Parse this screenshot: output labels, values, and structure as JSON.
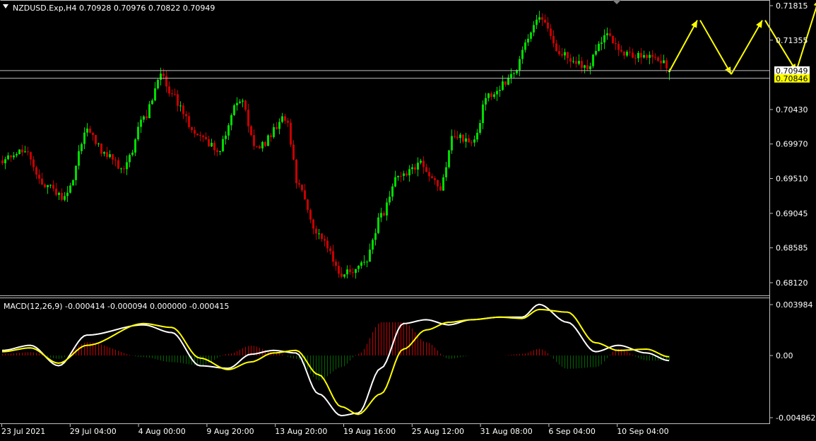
{
  "main_info": "NZDUSD.Exp,H4  0.70928 0.70976 0.70822 0.70949",
  "macd_info": "MACD(12,26,9) -0.000414 -0.000094 0.000000 -0.000415",
  "colors": {
    "bull": "#00dc00",
    "bear": "#c80000",
    "macd_hist_pos": "#c00000",
    "macd_hist_neg": "#006400",
    "macd_line": "#ffffff",
    "signal_line": "#ffff00",
    "arrow": "#ffff00",
    "bid_tag_bg": "#ffffff",
    "ask_tag_bg": "#ffff00"
  },
  "price_axis": {
    "ticks": [
      {
        "label": "0.71815",
        "value": 0.71815
      },
      {
        "label": "0.71355",
        "value": 0.71355
      },
      {
        "label": "0.70430",
        "value": 0.7043
      },
      {
        "label": "0.69970",
        "value": 0.6997
      },
      {
        "label": "0.69510",
        "value": 0.6951
      },
      {
        "label": "0.69045",
        "value": 0.69045
      },
      {
        "label": "0.68585",
        "value": 0.68585
      },
      {
        "label": "0.68120",
        "value": 0.6812
      }
    ],
    "bid": {
      "label": "0.70949",
      "value": 0.70949
    },
    "ask": {
      "label": "0.70846",
      "value": 0.70846
    }
  },
  "macd_axis": {
    "ticks": [
      {
        "label": "0.003984",
        "value": 0.003984
      },
      {
        "label": "0.00",
        "value": 0.0
      },
      {
        "label": "-0.004862",
        "value": -0.004862
      }
    ]
  },
  "time_axis": {
    "labels": [
      "23 Jul 2021",
      "29 Jul 04:00",
      "4 Aug 00:00",
      "9 Aug 20:00",
      "13 Aug 20:00",
      "19 Aug 16:00",
      "25 Aug 12:00",
      "31 Aug 08:00",
      "6 Sep 04:00",
      "10 Sep 04:00"
    ]
  },
  "chart_data": {
    "type": "candlestick",
    "instrument": "NZDUSD.Exp",
    "timeframe": "H4",
    "last_bar": {
      "open": 0.70928,
      "high": 0.70976,
      "low": 0.70822,
      "close": 0.70949
    },
    "price_key_points": [
      {
        "bar": 0,
        "value": 0.6975
      },
      {
        "bar": 8,
        "value": 0.699
      },
      {
        "bar": 14,
        "value": 0.6945
      },
      {
        "bar": 22,
        "value": 0.6925
      },
      {
        "bar": 30,
        "value": 0.7015
      },
      {
        "bar": 36,
        "value": 0.6985
      },
      {
        "bar": 43,
        "value": 0.6965
      },
      {
        "bar": 50,
        "value": 0.703
      },
      {
        "bar": 56,
        "value": 0.709
      },
      {
        "bar": 60,
        "value": 0.706
      },
      {
        "bar": 68,
        "value": 0.7015
      },
      {
        "bar": 76,
        "value": 0.699
      },
      {
        "bar": 84,
        "value": 0.7055
      },
      {
        "bar": 90,
        "value": 0.699
      },
      {
        "bar": 100,
        "value": 0.703
      },
      {
        "bar": 105,
        "value": 0.694
      },
      {
        "bar": 112,
        "value": 0.6875
      },
      {
        "bar": 120,
        "value": 0.6825
      },
      {
        "bar": 128,
        "value": 0.6835
      },
      {
        "bar": 134,
        "value": 0.69
      },
      {
        "bar": 140,
        "value": 0.6955
      },
      {
        "bar": 148,
        "value": 0.697
      },
      {
        "bar": 155,
        "value": 0.694
      },
      {
        "bar": 160,
        "value": 0.701
      },
      {
        "bar": 166,
        "value": 0.7
      },
      {
        "bar": 172,
        "value": 0.706
      },
      {
        "bar": 180,
        "value": 0.7085
      },
      {
        "bar": 186,
        "value": 0.714
      },
      {
        "bar": 190,
        "value": 0.7165
      },
      {
        "bar": 198,
        "value": 0.7115
      },
      {
        "bar": 206,
        "value": 0.71
      },
      {
        "bar": 214,
        "value": 0.714
      },
      {
        "bar": 222,
        "value": 0.7115
      },
      {
        "bar": 232,
        "value": 0.7112
      },
      {
        "bar": 236,
        "value": 0.70949
      }
    ],
    "forecast_arrows": [
      {
        "from": {
          "bar": 236,
          "value": 0.7093
        },
        "to": {
          "bar": 246,
          "value": 0.7162
        }
      },
      {
        "from": {
          "bar": 247,
          "value": 0.7162
        },
        "to": {
          "bar": 258,
          "value": 0.709
        }
      },
      {
        "from": {
          "bar": 258,
          "value": 0.709
        },
        "to": {
          "bar": 269,
          "value": 0.7162
        }
      },
      {
        "from": {
          "bar": 270,
          "value": 0.7162
        },
        "to": {
          "bar": 281,
          "value": 0.7094
        }
      },
      {
        "from": {
          "bar": 281,
          "value": 0.7094
        },
        "to": {
          "bar": 289,
          "value": 0.719
        }
      }
    ],
    "macd_key_points": [
      {
        "bar": 0,
        "macd": 0.0004,
        "signal": 0.0003
      },
      {
        "bar": 10,
        "macd": 0.0008,
        "signal": 0.0006
      },
      {
        "bar": 20,
        "macd": -0.0008,
        "signal": -0.0006
      },
      {
        "bar": 30,
        "macd": 0.0016,
        "signal": 0.0008
      },
      {
        "bar": 50,
        "macd": 0.0024,
        "signal": 0.0025
      },
      {
        "bar": 60,
        "macd": 0.0018,
        "signal": 0.0022
      },
      {
        "bar": 70,
        "macd": -0.0008,
        "signal": -0.0002
      },
      {
        "bar": 80,
        "macd": -0.001,
        "signal": -0.0011
      },
      {
        "bar": 88,
        "macd": 0.0001,
        "signal": -0.0005
      },
      {
        "bar": 96,
        "macd": 0.0004,
        "signal": 0.0002
      },
      {
        "bar": 104,
        "macd": 0.0002,
        "signal": 0.0004
      },
      {
        "bar": 112,
        "macd": -0.003,
        "signal": -0.0015
      },
      {
        "bar": 120,
        "macd": -0.0047,
        "signal": -0.004
      },
      {
        "bar": 126,
        "macd": -0.0045,
        "signal": -0.0046
      },
      {
        "bar": 134,
        "macd": -0.001,
        "signal": -0.003
      },
      {
        "bar": 142,
        "macd": 0.0025,
        "signal": 0.0005
      },
      {
        "bar": 150,
        "macd": 0.0028,
        "signal": 0.002
      },
      {
        "bar": 158,
        "macd": 0.0024,
        "signal": 0.0026
      },
      {
        "bar": 166,
        "macd": 0.0028,
        "signal": 0.0028
      },
      {
        "bar": 176,
        "macd": 0.003,
        "signal": 0.003
      },
      {
        "bar": 184,
        "macd": 0.003,
        "signal": 0.0029
      },
      {
        "bar": 190,
        "macd": 0.004,
        "signal": 0.0036
      },
      {
        "bar": 200,
        "macd": 0.0026,
        "signal": 0.0034
      },
      {
        "bar": 210,
        "macd": 0.0003,
        "signal": 0.001
      },
      {
        "bar": 218,
        "macd": 0.0008,
        "signal": 0.0004
      },
      {
        "bar": 228,
        "macd": 0.0002,
        "signal": 0.0005
      },
      {
        "bar": 236,
        "macd": -0.0004,
        "signal": -0.0001
      }
    ]
  }
}
